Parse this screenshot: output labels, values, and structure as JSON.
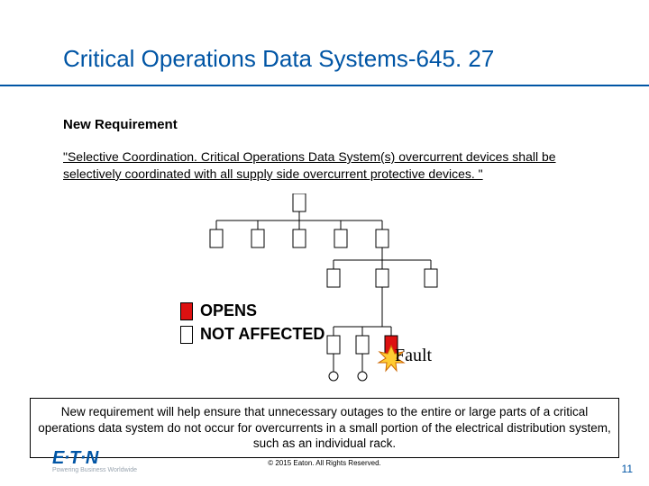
{
  "title": "Critical Operations Data Systems-645. 27",
  "subhead": "New Requirement",
  "body1": "\"Selective Coordination.  Critical Operations Data System(s) overcurrent devices shall be selectively coordinated with all supply side overcurrent protective devices. \"",
  "legend": {
    "opens": "OPENS",
    "not_affected": "NOT AFFECTED"
  },
  "fault_label": "Fault",
  "callout": "New requirement will help ensure that unnecessary outages to the entire or large parts of a critical operations data system do not occur for overcurrents in a small portion of the electrical distribution system, such as an individual rack.",
  "logo": {
    "main": "E·T·N",
    "sub": "Powering Business Worldwide"
  },
  "copyright": "© 2015 Eaton. All Rights Reserved.",
  "page_number": "11"
}
